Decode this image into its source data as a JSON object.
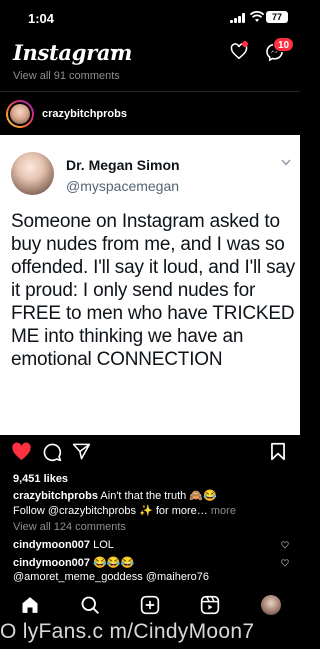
{
  "status_bar": {
    "time": "1:04",
    "battery": "77"
  },
  "header": {
    "logo": "Instagram",
    "messages_badge": "10"
  },
  "feed": {
    "view_all_previous": "View all 91 comments"
  },
  "post": {
    "username": "crazybitchprobs",
    "image": {
      "author_name": "Dr. Megan Simon",
      "author_handle": "@myspacemegan",
      "text": "Someone on Instagram asked to buy nudes from me, and I was so offended. I'll say it loud, and I'll say it proud: I only send nudes for FREE to men who have TRICKED ME into thinking we have an emotional CONNECTION"
    },
    "likes": "9,451 likes",
    "caption": {
      "username": "crazybitchprobs",
      "text": "Ain't that the truth 🙈😂",
      "line2": "Follow @crazybitchprobs ✨ for more…",
      "more": "more"
    },
    "view_all_comments": "View all 124 comments",
    "comments": [
      {
        "username": "cindymoon007",
        "text": "LOL"
      },
      {
        "username": "cindymoon007",
        "text": "😂😂😂",
        "line2": "@amoret_meme_goddess @maihero76"
      }
    ]
  },
  "watermark": "O lyFans.c m/CindyMoon7",
  "colors": {
    "badge": "#ff3040",
    "like_heart": "#ff3040",
    "muted_text": "#8e8e8e",
    "background": "#000000"
  },
  "icons": {
    "status": [
      "signal-icon",
      "wifi-icon",
      "battery-icon"
    ],
    "header": [
      "chevron-down-icon",
      "heart-icon",
      "messenger-icon"
    ],
    "actions": [
      "like-heart-icon",
      "comment-icon",
      "share-icon",
      "bookmark-icon"
    ],
    "nav": [
      "home-icon",
      "search-icon",
      "create-icon",
      "reels-icon",
      "profile-avatar"
    ]
  }
}
